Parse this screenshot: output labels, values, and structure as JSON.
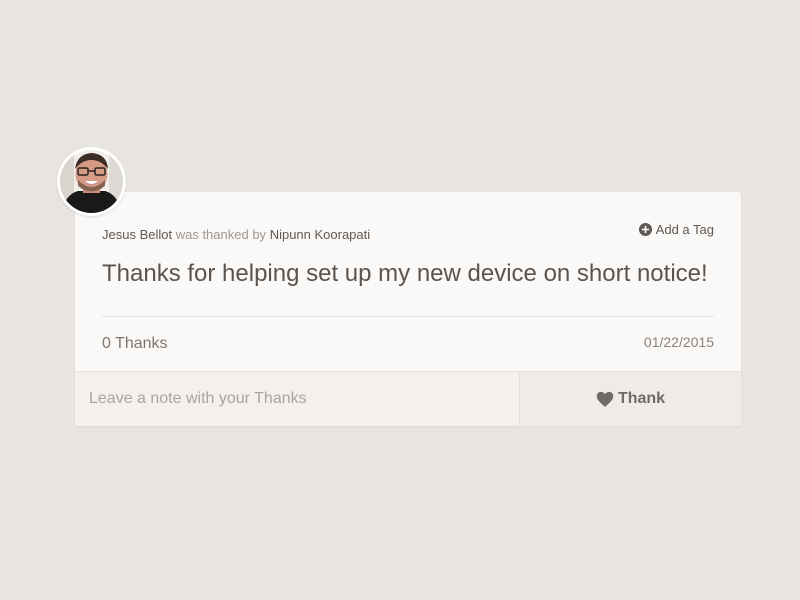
{
  "post": {
    "recipient": "Jesus Bellot",
    "thanked_by_text": "was thanked by",
    "sender": "Nipunn Koorapati",
    "add_tag_label": "Add a Tag",
    "message": "Thanks for helping set up my new device on short notice!",
    "thanks_count": "0 Thanks",
    "date": "01/22/2015"
  },
  "footer": {
    "note_placeholder": "Leave a note with your Thanks",
    "thank_label": "Thank"
  },
  "icons": {
    "add_tag": "plus-circle-icon",
    "thank": "heart-icon"
  },
  "colors": {
    "background": "#e8e4e0",
    "card": "#faf9f7",
    "footer": "#f3f0ed",
    "text": "#5a534e"
  }
}
